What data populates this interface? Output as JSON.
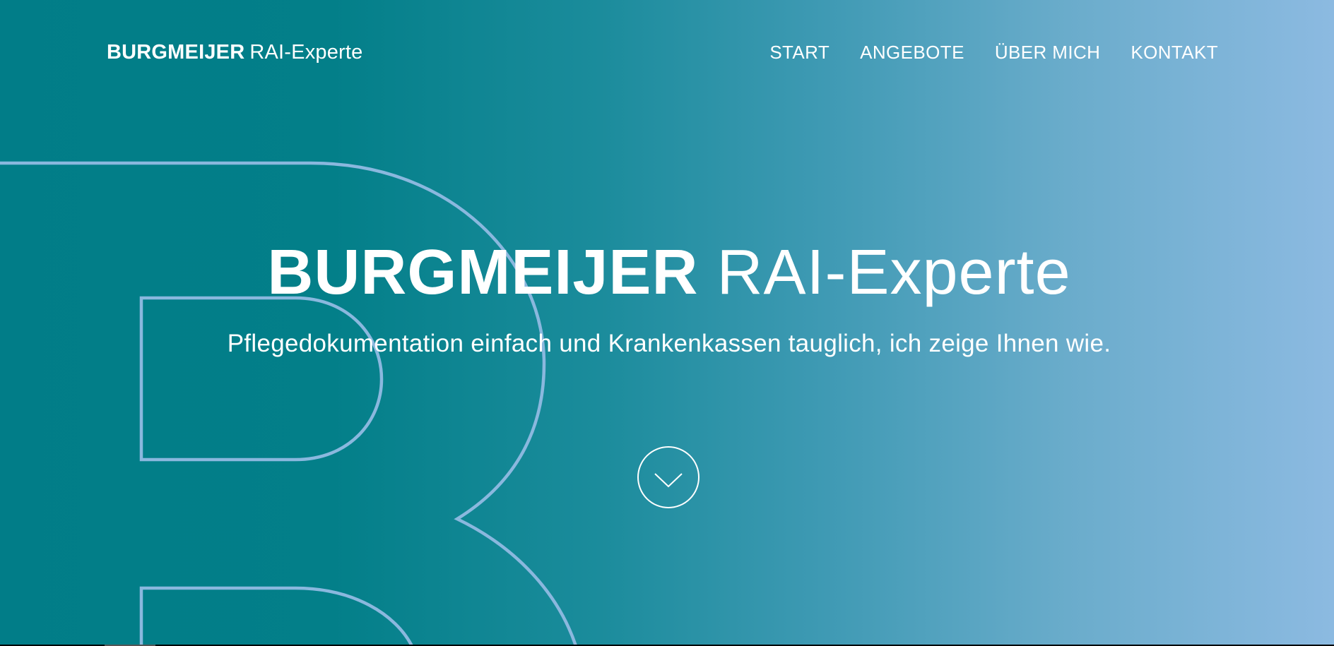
{
  "brand": {
    "bold": "BURGMEIJER",
    "light": "RAI-Experte"
  },
  "nav": {
    "items": [
      {
        "label": "START"
      },
      {
        "label": "ANGEBOTE"
      },
      {
        "label": "ÜBER MICH"
      },
      {
        "label": "KONTAKT"
      }
    ]
  },
  "hero": {
    "title_bold": "BURGMEIJER",
    "title_light": "RAI-Experte",
    "subtitle": "Pflegedokumentation einfach und Krankenkassen tauglich, ich zeige Ihnen wie."
  },
  "colors": {
    "gradient_start": "#017d88",
    "gradient_end": "#8cbae1",
    "outline": "#8ab8de",
    "text": "#ffffff"
  },
  "icons": {
    "scroll": "chevron-down-icon",
    "background": "letter-b-outline"
  }
}
